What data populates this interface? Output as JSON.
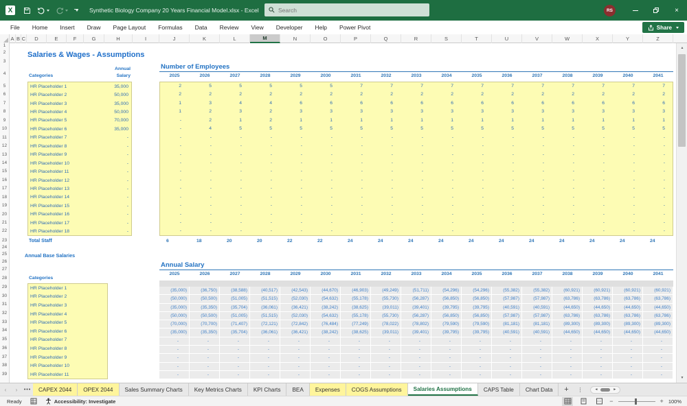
{
  "title_bar": {
    "title": "Synthetic Biology Company 20 Years Financial Model.xlsx  -  Excel",
    "search_placeholder": "Search",
    "avatar_initials": "RS",
    "app_icon_letter": "X"
  },
  "ribbon": {
    "tabs": [
      "File",
      "Home",
      "Insert",
      "Draw",
      "Page Layout",
      "Formulas",
      "Data",
      "Review",
      "View",
      "Developer",
      "Help",
      "Power Pivot"
    ],
    "share_label": "Share"
  },
  "grid": {
    "columns": [
      "A",
      "B",
      "C",
      "D",
      "E",
      "F",
      "G",
      "H",
      "I",
      "J",
      "K",
      "L",
      "M",
      "N",
      "O",
      "P",
      "Q",
      "R",
      "S",
      "T",
      "U",
      "V",
      "W",
      "X",
      "Y",
      "Z"
    ],
    "selected_column": "M",
    "row_count": 39
  },
  "sheet": {
    "page_title": "Salaries & Wages - Assumptions",
    "annual_base_salaries_label": "Annual Base Salaries",
    "staff_table": {
      "categories_header": "Categories",
      "salary_header_line1": "Annual",
      "salary_header_line2": "Salary",
      "total_label": "Total Staff",
      "categories": [
        "HR Placeholder 1",
        "HR Placeholder 2",
        "HR Placeholder 3",
        "HR Placeholder 4",
        "HR Placeholder 5",
        "HR Placeholder 6",
        "HR Placeholder 7",
        "HR Placeholder 8",
        "HR Placeholder 9",
        "HR Placeholder 10",
        "HR Placeholder 11",
        "HR Placeholder 12",
        "HR Placeholder 13",
        "HR Placeholder 14",
        "HR Placeholder 15",
        "HR Placeholder 16",
        "HR Placeholder 17",
        "HR Placeholder 18"
      ],
      "salaries": [
        "35,000",
        "50,000",
        "35,000",
        "50,000",
        "70,000",
        "35,000",
        "-",
        "-",
        "-",
        "-",
        "-",
        "-",
        "-",
        "-",
        "-",
        "-",
        "-",
        "-"
      ]
    },
    "base_salary_table": {
      "categories_header": "Categories",
      "categories": [
        "HR Placeholder 1",
        "HR Placeholder 2",
        "HR Placeholder 3",
        "HR Placeholder 4",
        "HR Placeholder 5",
        "HR Placeholder 6",
        "HR Placeholder 7",
        "HR Placeholder 8",
        "HR Placeholder 9",
        "HR Placeholder 10",
        "HR Placeholder 11"
      ]
    },
    "employees_table": {
      "title": "Number of Employees",
      "years": [
        "2025",
        "2026",
        "2027",
        "2028",
        "2029",
        "2030",
        "2031",
        "2032",
        "2033",
        "2034",
        "2035",
        "2036",
        "2037",
        "2038",
        "2039",
        "2040",
        "2041"
      ],
      "rows": [
        [
          "2",
          "5",
          "5",
          "5",
          "5",
          "5",
          "7",
          "7",
          "7",
          "7",
          "7",
          "7",
          "7",
          "7",
          "7",
          "7",
          "7"
        ],
        [
          "2",
          "2",
          "2",
          "2",
          "2",
          "2",
          "2",
          "2",
          "2",
          "2",
          "2",
          "2",
          "2",
          "2",
          "2",
          "2",
          "2"
        ],
        [
          "1",
          "3",
          "4",
          "4",
          "6",
          "6",
          "6",
          "6",
          "6",
          "6",
          "6",
          "6",
          "6",
          "6",
          "6",
          "6",
          "6"
        ],
        [
          "1",
          "2",
          "3",
          "2",
          "3",
          "3",
          "3",
          "3",
          "3",
          "3",
          "3",
          "3",
          "3",
          "3",
          "3",
          "3",
          "3"
        ],
        [
          "-",
          "2",
          "1",
          "2",
          "1",
          "1",
          "1",
          "1",
          "1",
          "1",
          "1",
          "1",
          "1",
          "1",
          "1",
          "1",
          "1"
        ],
        [
          "-",
          "4",
          "5",
          "5",
          "5",
          "5",
          "5",
          "5",
          "5",
          "5",
          "5",
          "5",
          "5",
          "5",
          "5",
          "5",
          "5"
        ],
        [
          "-",
          "-",
          "-",
          "-",
          "-",
          "-",
          "-",
          "-",
          "-",
          "-",
          "-",
          "-",
          "-",
          "-",
          "-",
          "-",
          "-"
        ],
        [
          "-",
          "-",
          "-",
          "-",
          "-",
          "-",
          "-",
          "-",
          "-",
          "-",
          "-",
          "-",
          "-",
          "-",
          "-",
          "-",
          "-"
        ],
        [
          "-",
          "-",
          "-",
          "-",
          "-",
          "-",
          "-",
          "-",
          "-",
          "-",
          "-",
          "-",
          "-",
          "-",
          "-",
          "-",
          "-"
        ],
        [
          "-",
          "-",
          "-",
          "-",
          "-",
          "-",
          "-",
          "-",
          "-",
          "-",
          "-",
          "-",
          "-",
          "-",
          "-",
          "-",
          "-"
        ],
        [
          "-",
          "-",
          "-",
          "-",
          "-",
          "-",
          "-",
          "-",
          "-",
          "-",
          "-",
          "-",
          "-",
          "-",
          "-",
          "-",
          "-"
        ],
        [
          "-",
          "-",
          "-",
          "-",
          "-",
          "-",
          "-",
          "-",
          "-",
          "-",
          "-",
          "-",
          "-",
          "-",
          "-",
          "-",
          "-"
        ],
        [
          "-",
          "-",
          "-",
          "-",
          "-",
          "-",
          "-",
          "-",
          "-",
          "-",
          "-",
          "-",
          "-",
          "-",
          "-",
          "-",
          "-"
        ],
        [
          "-",
          "-",
          "-",
          "-",
          "-",
          "-",
          "-",
          "-",
          "-",
          "-",
          "-",
          "-",
          "-",
          "-",
          "-",
          "-",
          "-"
        ],
        [
          "-",
          "-",
          "-",
          "-",
          "-",
          "-",
          "-",
          "-",
          "-",
          "-",
          "-",
          "-",
          "-",
          "-",
          "-",
          "-",
          "-"
        ],
        [
          "-",
          "-",
          "-",
          "-",
          "-",
          "-",
          "-",
          "-",
          "-",
          "-",
          "-",
          "-",
          "-",
          "-",
          "-",
          "-",
          "-"
        ],
        [
          "-",
          "-",
          "-",
          "-",
          "-",
          "-",
          "-",
          "-",
          "-",
          "-",
          "-",
          "-",
          "-",
          "-",
          "-",
          "-",
          "-"
        ],
        [
          "-",
          "-",
          "-",
          "-",
          "-",
          "-",
          "-",
          "-",
          "-",
          "-",
          "-",
          "-",
          "-",
          "-",
          "-",
          "-",
          "-"
        ]
      ],
      "totals": [
        "6",
        "18",
        "20",
        "20",
        "22",
        "22",
        "24",
        "24",
        "24",
        "24",
        "24",
        "24",
        "24",
        "24",
        "24",
        "24",
        "24"
      ]
    },
    "salary_table": {
      "title": "Annual Salary",
      "years": [
        "2025",
        "2026",
        "2027",
        "2028",
        "2029",
        "2030",
        "2031",
        "2032",
        "2033",
        "2034",
        "2035",
        "2036",
        "2037",
        "2038",
        "2039",
        "2040",
        "2041"
      ],
      "rows": [
        [
          "(35,000)",
          "(36,750)",
          "(38,588)",
          "(40,517)",
          "(42,543)",
          "(44,670)",
          "(46,903)",
          "(49,249)",
          "(51,711)",
          "(54,296)",
          "(54,296)",
          "(55,382)",
          "(55,382)",
          "(60,921)",
          "(60,921)",
          "(60,921)",
          "(60,921)"
        ],
        [
          "(50,000)",
          "(50,500)",
          "(51,005)",
          "(51,515)",
          "(52,030)",
          "(54,632)",
          "(55,178)",
          "(55,730)",
          "(56,287)",
          "(56,850)",
          "(56,850)",
          "(57,987)",
          "(57,987)",
          "(63,786)",
          "(63,786)",
          "(63,786)",
          "(63,786)"
        ],
        [
          "(35,000)",
          "(35,350)",
          "(35,704)",
          "(36,061)",
          "(36,421)",
          "(38,242)",
          "(38,625)",
          "(39,011)",
          "(39,401)",
          "(39,795)",
          "(39,795)",
          "(40,591)",
          "(40,591)",
          "(44,650)",
          "(44,650)",
          "(44,650)",
          "(44,650)"
        ],
        [
          "(50,000)",
          "(50,500)",
          "(51,005)",
          "(51,515)",
          "(52,030)",
          "(54,632)",
          "(55,178)",
          "(55,730)",
          "(56,287)",
          "(56,850)",
          "(56,850)",
          "(57,987)",
          "(57,987)",
          "(63,786)",
          "(63,786)",
          "(63,786)",
          "(63,786)"
        ],
        [
          "(70,000)",
          "(70,700)",
          "(71,407)",
          "(72,121)",
          "(72,842)",
          "(76,484)",
          "(77,249)",
          "(78,022)",
          "(78,802)",
          "(79,590)",
          "(79,590)",
          "(81,181)",
          "(81,181)",
          "(89,300)",
          "(89,300)",
          "(89,300)",
          "(89,300)"
        ],
        [
          "(35,000)",
          "(35,350)",
          "(35,704)",
          "(36,061)",
          "(36,421)",
          "(38,242)",
          "(38,625)",
          "(39,011)",
          "(39,401)",
          "(39,795)",
          "(39,795)",
          "(40,591)",
          "(40,591)",
          "(44,650)",
          "(44,650)",
          "(44,650)",
          "(44,650)"
        ],
        [
          "-",
          "-",
          "-",
          "-",
          "-",
          "-",
          "-",
          "-",
          "-",
          "-",
          "-",
          "-",
          "-",
          "-",
          "-",
          "-",
          "-"
        ],
        [
          "-",
          "-",
          "-",
          "-",
          "-",
          "-",
          "-",
          "-",
          "-",
          "-",
          "-",
          "-",
          "-",
          "-",
          "-",
          "-",
          "-"
        ],
        [
          "-",
          "-",
          "-",
          "-",
          "-",
          "-",
          "-",
          "-",
          "-",
          "-",
          "-",
          "-",
          "-",
          "-",
          "-",
          "-",
          "-"
        ],
        [
          "-",
          "-",
          "-",
          "-",
          "-",
          "-",
          "-",
          "-",
          "-",
          "-",
          "-",
          "-",
          "-",
          "-",
          "-",
          "-",
          "-"
        ],
        [
          "-",
          "-",
          "-",
          "-",
          "-",
          "-",
          "-",
          "-",
          "-",
          "-",
          "-",
          "-",
          "-",
          "-",
          "-",
          "-",
          "-"
        ]
      ]
    }
  },
  "sheet_tabs": {
    "tabs": [
      {
        "label": "CAPEX 2044",
        "style": "yellow"
      },
      {
        "label": "OPEX 2044",
        "style": "yellow"
      },
      {
        "label": "Sales Summary Charts",
        "style": "normal"
      },
      {
        "label": "Key Metrics Charts",
        "style": "normal"
      },
      {
        "label": "KPI Charts",
        "style": "normal"
      },
      {
        "label": "BEA",
        "style": "normal"
      },
      {
        "label": "Expenses",
        "style": "yellow"
      },
      {
        "label": "COGS Assumptions",
        "style": "yellow"
      },
      {
        "label": "Salaries Assumptions",
        "style": "active"
      },
      {
        "label": "CAPS Table",
        "style": "normal"
      },
      {
        "label": "Chart Data",
        "style": "normal"
      }
    ]
  },
  "status_bar": {
    "ready_label": "Ready",
    "accessibility_label": "Accessibility: Investigate",
    "zoom_level": "100%"
  },
  "colors": {
    "titlebar_green": "#1E6E41",
    "accent_green": "#217346",
    "input_yellow": "#FDFCB4",
    "data_blue": "#2F6DB5",
    "header_blue": "#2272C3",
    "tab_yellow": "#FFF59C"
  }
}
